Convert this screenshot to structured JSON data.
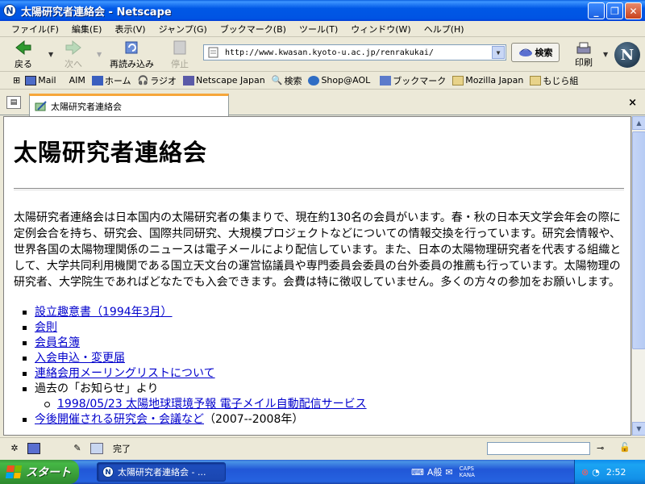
{
  "window": {
    "title": "太陽研究者連絡会 - Netscape",
    "app_icon_letter": "N",
    "minimize": "_",
    "maximize": "❐",
    "close": "✕"
  },
  "menubar": [
    "ファイル(F)",
    "編集(E)",
    "表示(V)",
    "ジャンプ(G)",
    "ブックマーク(B)",
    "ツール(T)",
    "ウィンドウ(W)",
    "ヘルプ(H)"
  ],
  "nav": {
    "back": "戻る",
    "forward": "次へ",
    "reload": "再読み込み",
    "stop": "停止",
    "url": "http://www.kwasan.kyoto-u.ac.jp/renrakukai/",
    "search": "検索",
    "print": "印刷",
    "logo": "N"
  },
  "personal_toolbar": [
    "Mail",
    "AIM",
    "ホーム",
    "ラジオ",
    "Netscape Japan",
    "検索",
    "Shop@AOL",
    "ブックマーク",
    "Mozilla Japan",
    "もじら組"
  ],
  "tab": {
    "label": "太陽研究者連絡会",
    "close": "×"
  },
  "page": {
    "heading": "太陽研究者連絡会",
    "intro": "太陽研究者連絡会は日本国内の太陽研究者の集まりで、現在約130名の会員がいます。春・秋の日本天文学会年会の際に定例会合を持ち、研究会、国際共同研究、大規模プロジェクトなどについての情報交換を行っています。研究会情報や、世界各国の太陽物理関係のニュースは電子メールにより配信しています。また、日本の太陽物理研究者を代表する組織として、大学共同利用機関である国立天文台の運営協議員や専門委員会委員の台外委員の推薦も行っています。太陽物理の研究者、大学院生であればどなたでも入会できます。会費は特に徴収していません。多くの方々の参加をお願いします。",
    "links": {
      "prospectus": "設立趣意書（1994年3月）",
      "rules": "会則",
      "members": "会員名簿",
      "join": "入会申込・変更届",
      "mailing_list": "連絡会用メーリングリストについて",
      "past_news_label": "過去の「お知らせ」より",
      "past_news_item": "1998/05/23 太陽地球環境予報 電子メイル自動配信サービス",
      "upcoming": "今後開催される研究会・会議など",
      "upcoming_suffix": "（2007--2008年）"
    }
  },
  "statusbar": {
    "text": "完了"
  },
  "taskbar": {
    "start": "スタート",
    "task": "太陽研究者連絡会 - ...",
    "ime": "A般",
    "caps": "CAPS",
    "kana": "KANA",
    "clock": "2:52"
  }
}
